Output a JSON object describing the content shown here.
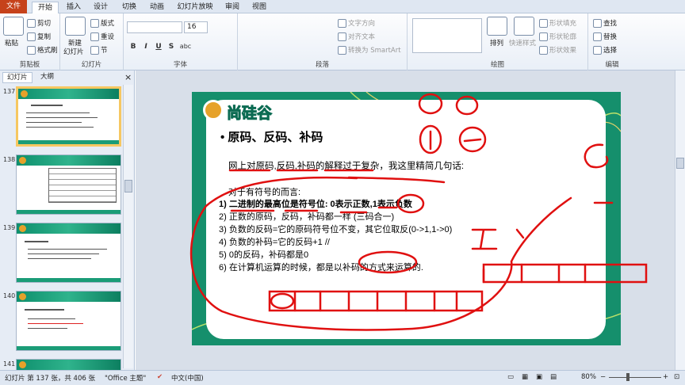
{
  "tabs": [
    {
      "label": "文件"
    },
    {
      "label": "开始"
    },
    {
      "label": "插入"
    },
    {
      "label": "设计"
    },
    {
      "label": "切换"
    },
    {
      "label": "动画"
    },
    {
      "label": "幻灯片放映"
    },
    {
      "label": "审阅"
    },
    {
      "label": "视图"
    }
  ],
  "ribbon": {
    "clipboard": {
      "paste": "粘贴",
      "cut": "剪切",
      "copy": "复制",
      "format_painter": "格式刷",
      "label": "剪贴板"
    },
    "slides": {
      "new_slide": "新建",
      "new_slide2": "幻灯片",
      "layout": "版式",
      "reset": "重设",
      "section": "节",
      "label": "幻灯片"
    },
    "font": {
      "size": "16",
      "bold": "B",
      "italic": "I",
      "underline": "U",
      "strike": "S",
      "shadow": "abc",
      "label": "字体"
    },
    "paragraph": {
      "text_dir": "文字方向",
      "align_text": "对齐文本",
      "smartart": "转换为 SmartArt",
      "label": "段落"
    },
    "drawing": {
      "arrange": "排列",
      "quick_styles": "快速样式",
      "fill": "形状填充",
      "outline": "形状轮廓",
      "effects": "形状效果",
      "label": "绘图"
    },
    "editing": {
      "find": "查找",
      "replace": "替换",
      "select": "选择",
      "label": "编辑"
    }
  },
  "panel": {
    "tab_slides": "幻灯片",
    "tab_outline": "大纲",
    "close": "×",
    "thumbs": [
      {
        "num": "137"
      },
      {
        "num": "138"
      },
      {
        "num": "139"
      },
      {
        "num": "140"
      },
      {
        "num": "141"
      }
    ]
  },
  "slide": {
    "logo_text": "尚硅谷",
    "title": "原码、反码、补码",
    "intro": "网上对原码,反码,补码的解释过于复杂，我这里精简几句话:",
    "lead": "对于有符号的而言:",
    "items": [
      "1) 二进制的最高位是符号位: 0表示正数,1表示负数",
      "2) 正数的原码，反码，补码都一样 (三码合一)",
      "3) 负数的反码=它的原码符号位不变，其它位取反(0->1,1->0)",
      "4) 负数的补码=它的反码+1   //",
      "5) 0的反码，补码都是0",
      "6) 在计算机运算的时候，都是以补码的方式来运算的."
    ]
  },
  "status": {
    "slide_info": "幻灯片 第 137 张，共 406 张",
    "theme": "\"Office 主题\"",
    "lang": "中文(中国)",
    "zoom": "80%"
  },
  "colors": {
    "file_tab": "#c6421b",
    "slide_green": "#158f6c",
    "annotation_red": "#e01010"
  }
}
